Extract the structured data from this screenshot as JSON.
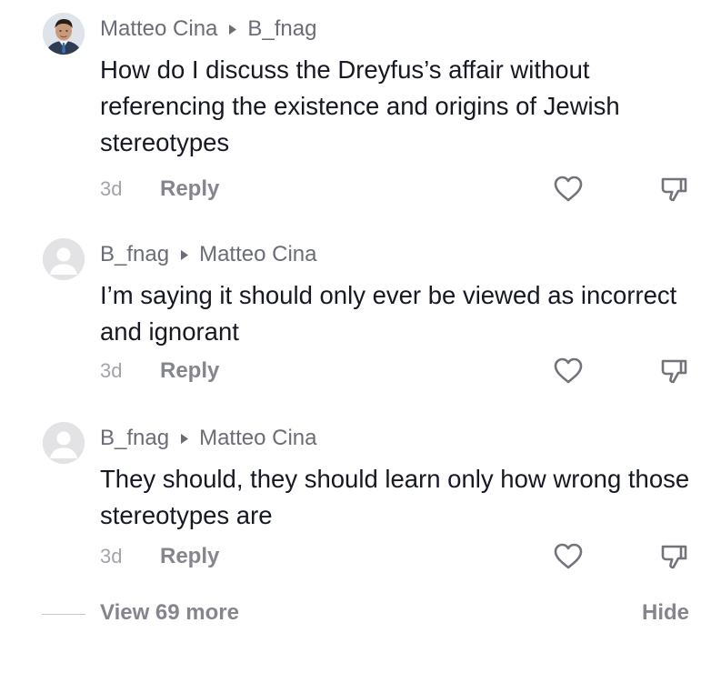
{
  "comments": [
    {
      "author": "Matteo Cina",
      "reply_to": "B_fnag",
      "text": "How do I discuss the Dreyfus’s affair without referencing the existence and origins of Jewish stereotypes",
      "time": "3d",
      "reply_label": "Reply",
      "avatar": "profile-photo"
    },
    {
      "author": "B_fnag",
      "reply_to": "Matteo Cina",
      "text": "I’m saying it should only ever be viewed as incorrect and ignorant",
      "time": "3d",
      "reply_label": "Reply",
      "avatar": "default-avatar"
    },
    {
      "author": "B_fnag",
      "reply_to": "Matteo Cina",
      "text": "They should, they should learn only how wrong those stereotypes are",
      "time": "3d",
      "reply_label": "Reply",
      "avatar": "default-avatar"
    }
  ],
  "icons": {
    "like": "heart-icon",
    "dislike": "thumbs-down-icon",
    "separator": "triangle-right-icon"
  },
  "footer": {
    "view_more": "View 69 more",
    "hide": "Hide"
  },
  "colors": {
    "username": "#6b6d76",
    "body_text": "#161823",
    "secondary": "#85868d",
    "timestamp": "#a3a4aa"
  }
}
